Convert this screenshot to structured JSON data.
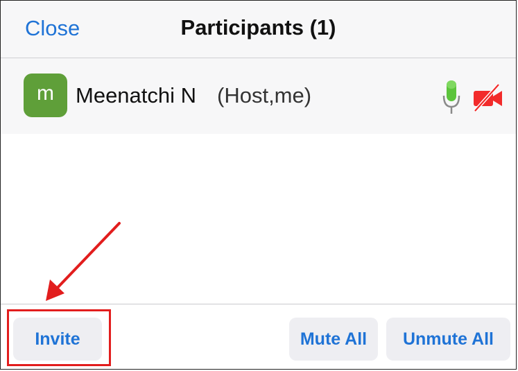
{
  "header": {
    "close_label": "Close",
    "title": "Participants (1)"
  },
  "participants": [
    {
      "initial": "m",
      "name": "Meenatchi N",
      "role": "(Host,me)",
      "mic_icon": "microphone-on-icon",
      "camera_icon": "video-off-icon"
    }
  ],
  "footer": {
    "invite_label": "Invite",
    "mute_all_label": "Mute All",
    "unmute_all_label": "Unmute All"
  },
  "colors": {
    "accent": "#1f73d6",
    "avatar_bg": "#5f9f39",
    "mic_green": "#5cc43c",
    "cam_red": "#f22b2b",
    "annotation_red": "#e21d1d"
  }
}
